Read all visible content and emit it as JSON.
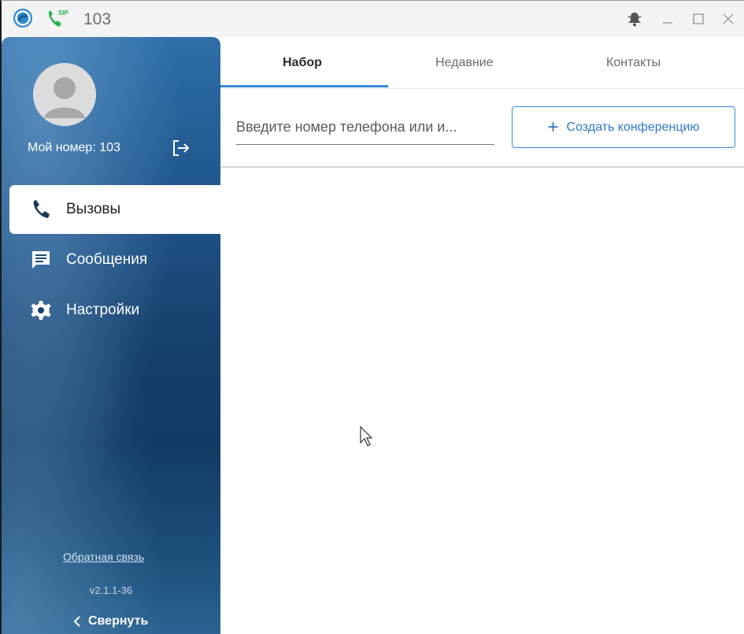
{
  "titlebar": {
    "title": "103",
    "sip_badge": "SIP",
    "icons": {
      "app_logo": "app-logo-icon",
      "phone": "sip-phone-icon",
      "bell": "bell-icon",
      "minimize": "minimize-icon",
      "maximize": "maximize-icon",
      "close": "close-icon"
    }
  },
  "sidebar": {
    "my_number_label": "Мой номер: 103",
    "items": [
      {
        "label": "Вызовы",
        "icon": "phone-icon",
        "active": true
      },
      {
        "label": "Сообщения",
        "icon": "message-icon",
        "active": false
      },
      {
        "label": "Настройки",
        "icon": "gear-icon",
        "active": false
      }
    ],
    "feedback_link": "Обратная связь",
    "version": "v2.1.1-36",
    "collapse_label": "Свернуть"
  },
  "tabs": [
    {
      "label": "Набор",
      "active": true
    },
    {
      "label": "Недавние",
      "active": false
    },
    {
      "label": "Контакты",
      "active": false
    }
  ],
  "dialer": {
    "placeholder": "Введите номер телефона или и...",
    "conference_button": "Создать конференцию"
  },
  "colors": {
    "accent": "#3a8bd4",
    "sidebar_dark": "#123a63",
    "sidebar_light": "#2e6ea8",
    "sip_green": "#2bb24c"
  }
}
